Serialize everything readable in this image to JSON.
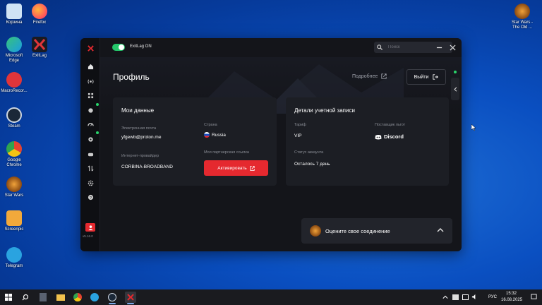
{
  "desktop": {
    "icons_left": [
      {
        "label": "Корзина",
        "name": "recycle-bin-icon",
        "color": "#cfe3f5"
      },
      {
        "label": "Microsoft Edge",
        "name": "edge-icon",
        "color": "#1b9de2"
      },
      {
        "label": "MacroRecor...",
        "name": "macro-recorder-icon",
        "color": "#e0353a"
      },
      {
        "label": "Steam",
        "name": "steam-icon",
        "color": "#1b2838"
      },
      {
        "label": "Google Chrome",
        "name": "chrome-icon",
        "color": "#e7b416"
      },
      {
        "label": "Star Wars",
        "name": "star-wars-icon",
        "color": "#c98a2a"
      },
      {
        "label": "Screenpic",
        "name": "screenpic-icon",
        "color": "#f2a93b"
      },
      {
        "label": "Telegram",
        "name": "telegram-icon",
        "color": "#2aa3e0"
      }
    ],
    "icons_col2": [
      {
        "label": "Firefox",
        "name": "firefox-icon",
        "color": "#ff7139"
      },
      {
        "label": "ExitLag",
        "name": "exitlag-icon",
        "color": "#e0353a"
      }
    ],
    "icon_right": {
      "label": "Star Wars - The Old ...",
      "name": "star-wars-tor-icon",
      "color": "#c98a2a"
    }
  },
  "app": {
    "toggle_label": "ExitLag ON",
    "search_placeholder": "Поиск",
    "page_title": "Профиль",
    "more_link": "Подробнее",
    "logout_label": "Выйти",
    "version": "v5.16.0",
    "my_data": {
      "title": "Мои данные",
      "email_label": "Электронная почта",
      "email_value": "yfgewb@proton.me",
      "isp_label": "Интернет-провайдер",
      "isp_value": "CORBINA-BROADBAND",
      "country_label": "Страна",
      "country_value": "Russia",
      "partner_label": "Моя партнерская ссылка",
      "activate_label": "Активировать"
    },
    "account": {
      "title": "Детали учетной записи",
      "plan_label": "Тариф",
      "plan_value": "VIP",
      "provider_label": "Поставщик льгот",
      "provider_value": "Discord",
      "status_label": "Статус аккаунта",
      "status_value": "Осталось 7 день"
    },
    "rate_text": "Оцените свое соединение",
    "accent_color": "#e5292f",
    "toggle_color": "#24c76b"
  },
  "taskbar": {
    "lang": "РУС",
    "time": "15:32",
    "date": "16.08.2025"
  }
}
